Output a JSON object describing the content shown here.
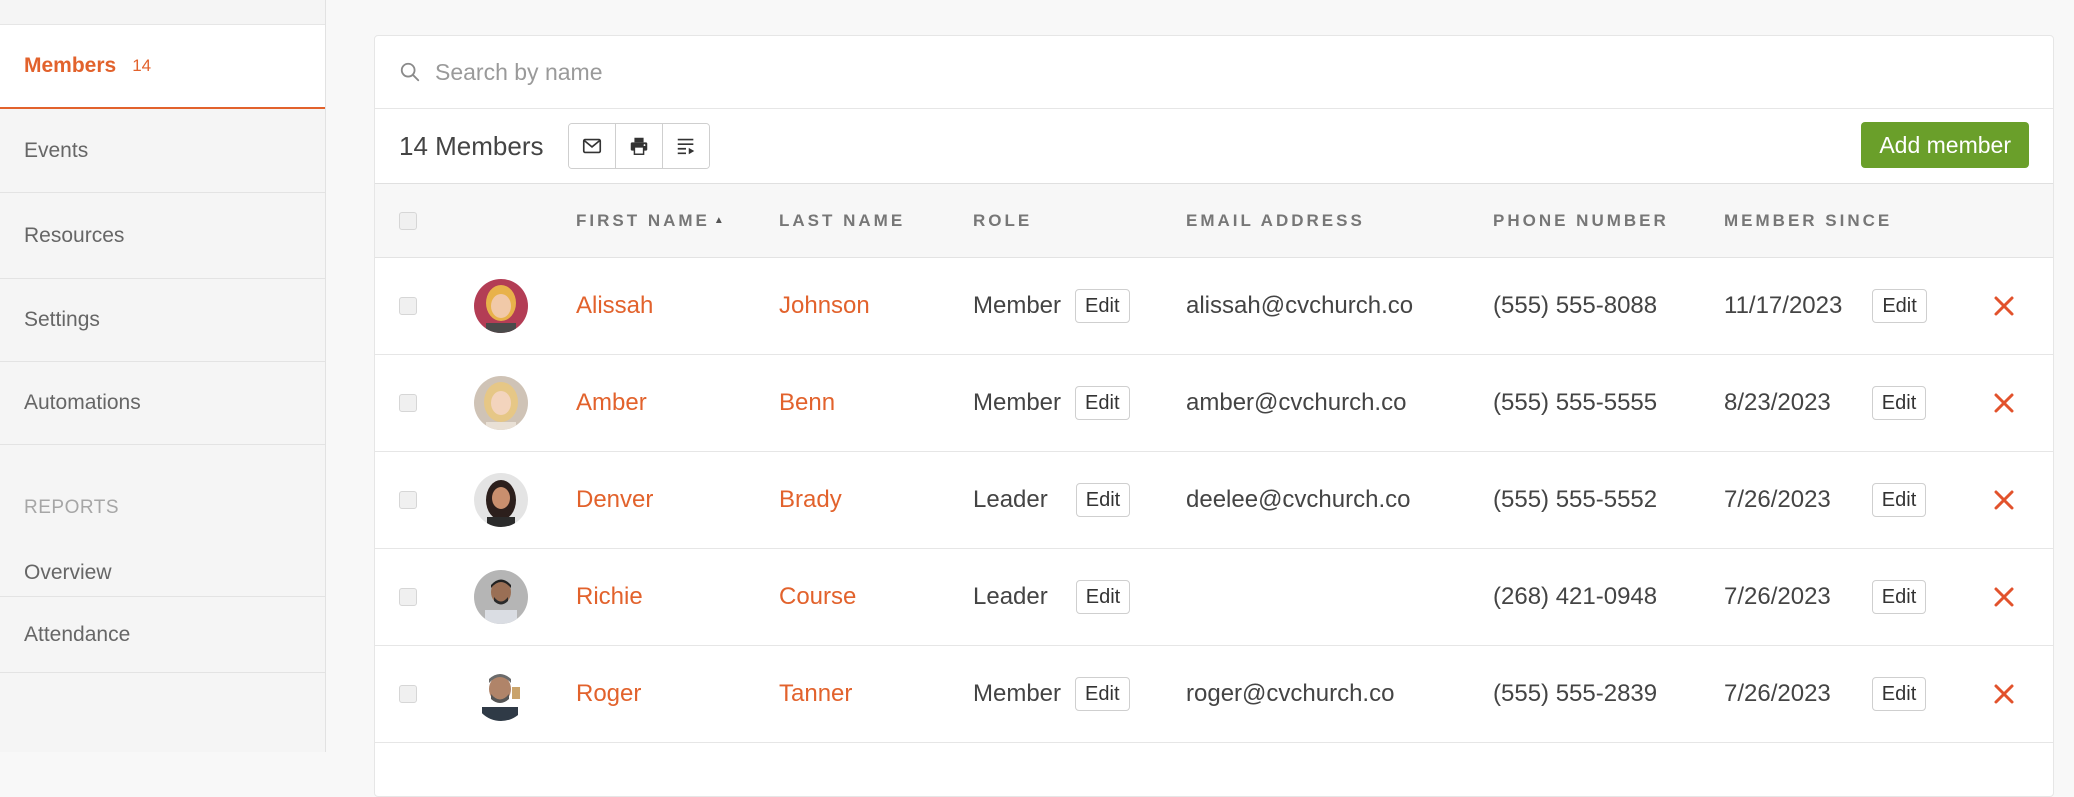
{
  "sidebar": {
    "items": [
      {
        "label": "Members",
        "count": "14",
        "active": true
      },
      {
        "label": "Events"
      },
      {
        "label": "Resources"
      },
      {
        "label": "Settings"
      },
      {
        "label": "Automations"
      }
    ],
    "reports_heading": "REPORTS",
    "report_items": [
      {
        "label": "Overview"
      },
      {
        "label": "Attendance"
      }
    ]
  },
  "search": {
    "placeholder": "Search by name",
    "value": ""
  },
  "toolbar": {
    "count_label": "14 Members",
    "icons": [
      "mail-icon",
      "print-icon",
      "sort-list-icon"
    ],
    "add_label": "Add member"
  },
  "table": {
    "columns": [
      "FIRST NAME",
      "LAST NAME",
      "ROLE",
      "EMAIL ADDRESS",
      "PHONE NUMBER",
      "MEMBER SINCE"
    ],
    "sorted_column": "FIRST NAME",
    "edit_label": "Edit",
    "rows": [
      {
        "first": "Alissah",
        "last": "Johnson",
        "role": "Member",
        "email": "alissah@cvchurch.co",
        "phone": "(555) 555-8088",
        "since": "11/17/2023",
        "avatar_color": "#c4405a"
      },
      {
        "first": "Amber",
        "last": "Benn",
        "role": "Member",
        "email": "amber@cvchurch.co",
        "phone": "(555) 555-5555",
        "since": "8/23/2023",
        "avatar_color": "#d9b58a"
      },
      {
        "first": "Denver",
        "last": "Brady",
        "role": "Leader",
        "email": "deelee@cvchurch.co",
        "phone": "(555) 555-5552",
        "since": "7/26/2023",
        "avatar_color": "#d8d8d8"
      },
      {
        "first": "Richie",
        "last": "Course",
        "role": "Leader",
        "email": "",
        "phone": "(268) 421-0948",
        "since": "7/26/2023",
        "avatar_color": "#a9a9a9"
      },
      {
        "first": "Roger",
        "last": "Tanner",
        "role": "Member",
        "email": "roger@cvchurch.co",
        "phone": "(555) 555-2839",
        "since": "7/26/2023",
        "avatar_color": "#7a8a96"
      }
    ]
  },
  "colors": {
    "accent": "#e2622c",
    "primary_button": "#6a9f2a",
    "delete": "#e2522c"
  }
}
